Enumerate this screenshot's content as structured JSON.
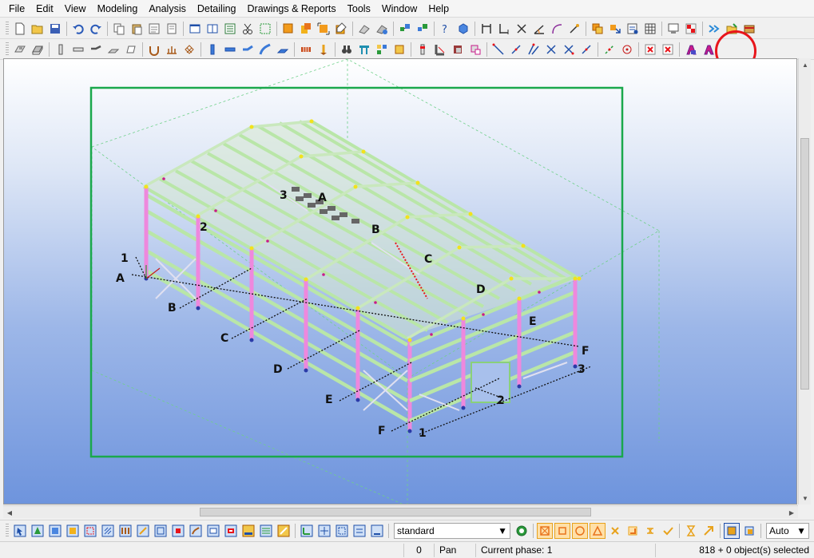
{
  "menubar": {
    "items": [
      "File",
      "Edit",
      "View",
      "Modeling",
      "Analysis",
      "Detailing",
      "Drawings & Reports",
      "Tools",
      "Window",
      "Help"
    ]
  },
  "toolbar1": {
    "icons": [
      "new-icon",
      "open-icon",
      "save-icon",
      "undo-icon",
      "redo-icon",
      "copy-icon",
      "paste-icon",
      "copy-special-icon",
      "move-icon",
      "window-icon",
      "window-tiled-icon",
      "properties-icon",
      "cut-icon",
      "select-area-icon",
      "part-icon",
      "component-icon",
      "fit-icon",
      "edit-icon",
      "zoom-in-icon",
      "zoom-out-icon",
      "snap-icon",
      "model-check-icon",
      "help-icon",
      "view-icon",
      "perp-icon",
      "dimension-icon",
      "angle-icon",
      "arc-icon",
      "point-icon",
      "layers-icon",
      "filter-icon",
      "clash-icon",
      "report-icon",
      "grid-icon",
      "arrows-icon",
      "export-icon",
      "import-icon"
    ]
  },
  "toolbar2": {
    "icons": [
      "plate-icon",
      "slab-icon",
      "column-icon",
      "beam-icon",
      "polybeam-icon",
      "twin-icon",
      "contour-icon",
      "bolt-icon",
      "weld-icon",
      "mesh-icon",
      "concrete-column-icon",
      "concrete-beam-icon",
      "curved-beam-icon",
      "orthogonal-beam-icon",
      "pad-icon",
      "rebar-icon",
      "binoculars-icon",
      "truss-icon",
      "frame-icon",
      "part-cut-icon",
      "fitting-icon",
      "chamfer-icon",
      "line-cut-icon",
      "polygon-cut-icon",
      "point-tool-icon",
      "line-tool-icon",
      "arc-tool-icon",
      "circle-tool-icon",
      "construction-line-icon",
      "construction-circle-icon",
      "delete-icon",
      "delete-all-icon",
      "create-assembly-icon",
      "create-cast-unit-icon"
    ]
  },
  "viewport": {
    "grid_labels_left": [
      "1",
      "A",
      "B",
      "C",
      "D",
      "E",
      "F"
    ],
    "grid_labels_right": [
      "F",
      "3"
    ],
    "grid_labels_roof": [
      "3",
      "A",
      "B",
      "C",
      "D",
      "E"
    ],
    "grid_labels_bottom": [
      "2",
      "1"
    ],
    "grid_label_2_left": "2"
  },
  "bottom_toolbar": {
    "view_filter": "standard",
    "snap_mode": "Auto",
    "icons": [
      "select-all-icon",
      "select-part-icon",
      "select-surface-icon",
      "select-point-icon",
      "select-line-icon",
      "select-group-icon",
      "select-filter-icon",
      "select-weld-icon",
      "select-component-icon",
      "select-connection-icon",
      "select-detail-icon",
      "select-seam-icon",
      "select-assembly-icon",
      "select-object-icon",
      "select-bolt-icon",
      "select-drawing-icon",
      "select-sketch-icon",
      "snap-end-icon",
      "snap-center-icon",
      "snap-mid-icon",
      "snap-intersection-icon",
      "snap-perpendicular-icon",
      "snap-line-icon",
      "snap-nearest-icon",
      "snap-free-icon",
      "snap-reference-icon",
      "snap-geometry-icon",
      "snap-override-icon"
    ]
  },
  "statusbar": {
    "coordinate": "0",
    "mode": "Pan",
    "phase": "Current phase: 1",
    "selection": "818 + 0 object(s) selected"
  },
  "colors": {
    "accent": "#e8151b",
    "viewport_top": "#ffffff",
    "viewport_bottom": "#6e94dd",
    "frame_green": "#1aa84c",
    "member_green": "#b9e6a8",
    "column_pink": "#ee88dd"
  }
}
